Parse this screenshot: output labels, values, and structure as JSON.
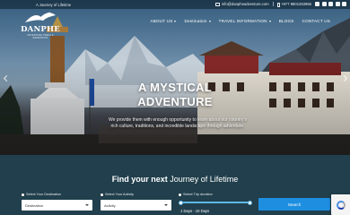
{
  "topbar": {
    "tagline": "A Journey of Lifetime",
    "email": "info@danpheadventure.com",
    "phone": "+977 9801263956"
  },
  "brand": {
    "name": "DANPHE",
    "subtitle": "ADVENTURE TREKS & EXPEDITION"
  },
  "nav": {
    "items": [
      {
        "label": "ABOUT US",
        "dropdown": true
      },
      {
        "label": "Destination",
        "dropdown": true
      },
      {
        "label": "TRAVEL INFORMATION",
        "dropdown": true
      },
      {
        "label": "BLOGS",
        "dropdown": false
      },
      {
        "label": "CONTACT US",
        "dropdown": false
      }
    ]
  },
  "hero": {
    "title_line1": "A MYSTICAL",
    "title_line2": "ADVENTURE",
    "description": "We provide them with enough opportunity to learn about our country's rich culture, traditions, and incredible landscape through adventure."
  },
  "search": {
    "heading_bold": "Find your next ",
    "heading_light": "Journey of Lifetime",
    "destination_label": "Select Your Destination",
    "destination_value": "Destination",
    "activity_label": "Select Your Activity",
    "activity_value": "Activity",
    "duration_label": "Select Trip duration",
    "duration_min": "1 Days",
    "duration_max": "10 Days",
    "duration_range_text": "1 Days - 10 Days",
    "button_label": "Search"
  },
  "colors": {
    "search_bg": "#213f4c",
    "accent": "#1e8fe0",
    "slider": "#5fb8e8"
  }
}
